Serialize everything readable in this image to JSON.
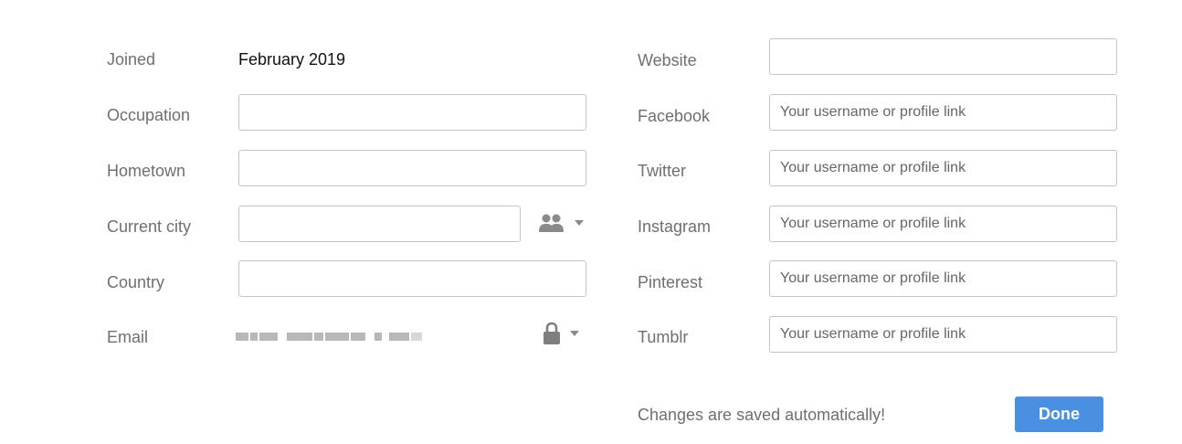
{
  "left": {
    "joined_label": "Joined",
    "joined_value": "February 2019",
    "occupation_label": "Occupation",
    "occupation_value": "",
    "hometown_label": "Hometown",
    "hometown_value": "",
    "current_city_label": "Current city",
    "current_city_value": "",
    "current_city_privacy_icon": "people-icon",
    "country_label": "Country",
    "country_value": "",
    "email_label": "Email",
    "email_privacy_icon": "lock-icon"
  },
  "right": {
    "website_label": "Website",
    "website_value": "",
    "facebook_label": "Facebook",
    "twitter_label": "Twitter",
    "instagram_label": "Instagram",
    "pinterest_label": "Pinterest",
    "tumblr_label": "Tumblr",
    "social_placeholder": "Your username or profile link"
  },
  "footer": {
    "status_text": "Changes are saved automatically!",
    "done_label": "Done"
  },
  "colors": {
    "label": "#6f6f6f",
    "border": "#c4c4c4",
    "accent": "#4a90e2"
  }
}
